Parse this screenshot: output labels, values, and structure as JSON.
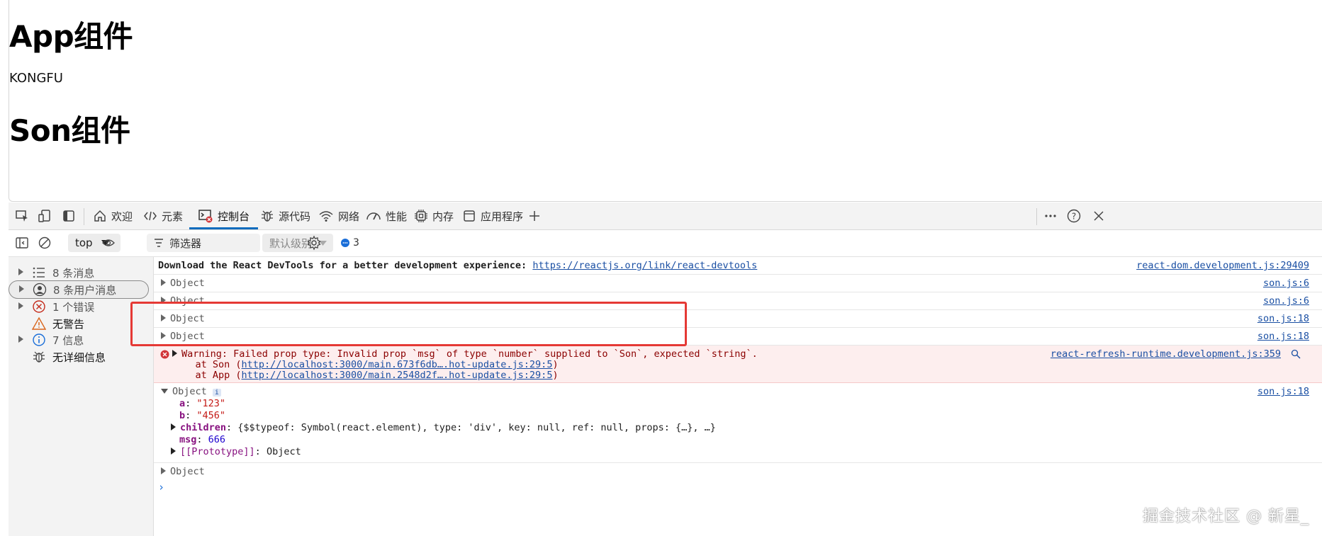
{
  "page": {
    "app_title": "App组件",
    "app_msg": "KONGFU",
    "son_title": "Son组件"
  },
  "devtools": {
    "tabs": [
      {
        "label": "欢迎",
        "icon": "home-icon"
      },
      {
        "label": "元素",
        "icon": "code-icon"
      },
      {
        "label": "控制台",
        "icon": "console-icon",
        "active": true
      },
      {
        "label": "源代码",
        "icon": "bug-icon"
      },
      {
        "label": "网络",
        "icon": "wifi-icon"
      },
      {
        "label": "性能",
        "icon": "performance-icon"
      },
      {
        "label": "内存",
        "icon": "memory-icon"
      },
      {
        "label": "应用程序",
        "icon": "application-icon"
      }
    ],
    "toolbar": {
      "context": "top",
      "filter_placeholder": "筛选器",
      "levels": "默认级别",
      "issue_count": "3"
    },
    "sidebar": [
      {
        "label": "8 条消息",
        "icon": "list-icon",
        "arrow": true
      },
      {
        "label": "8 条用户消息",
        "icon": "user-icon",
        "arrow": true,
        "selected": true
      },
      {
        "label": "1 个错误",
        "icon": "error-icon",
        "arrow": true
      },
      {
        "label": "无警告",
        "icon": "warning-icon",
        "arrow": false
      },
      {
        "label": "7 信息",
        "icon": "info-icon",
        "arrow": true
      },
      {
        "label": "无详细信息",
        "icon": "bug-icon",
        "arrow": false
      }
    ],
    "console": {
      "devtools_msg": "Download the React DevTools for a better development experience: ",
      "devtools_link": "https://reactjs.org/link/react-devtools",
      "devtools_src": "react-dom.development.js:29409",
      "object_label": "Object",
      "src_son6": "son.js:6",
      "src_son18": "son.js:18",
      "warning_line1": "Warning: Failed prop type: Invalid prop `msg` of type `number` supplied to `Son`, expected `string`.",
      "warning_at_son": "    at Son (",
      "warning_son_link": "http://localhost:3000/main.673f6db….hot-update.js:29:5",
      "warning_at_app": "    at App (",
      "warning_app_link": "http://localhost:3000/main.2548d2f….hot-update.js:29:5",
      "close_paren": ")",
      "warning_src": "react-refresh-runtime.development.js:359",
      "expanded": {
        "a_key": "a",
        "a_val": "\"123\"",
        "b_key": "b",
        "b_val": "\"456\"",
        "children_key": "children",
        "children_val": "{$$typeof: Symbol(react.element), type: 'div', key: null, ref: null, props: {…}, …}",
        "msg_key": "msg",
        "msg_val": "666",
        "proto_key": "[[Prototype]]",
        "proto_val": "Object"
      }
    }
  },
  "watermark": "掘金技术社区 @ 新星_"
}
